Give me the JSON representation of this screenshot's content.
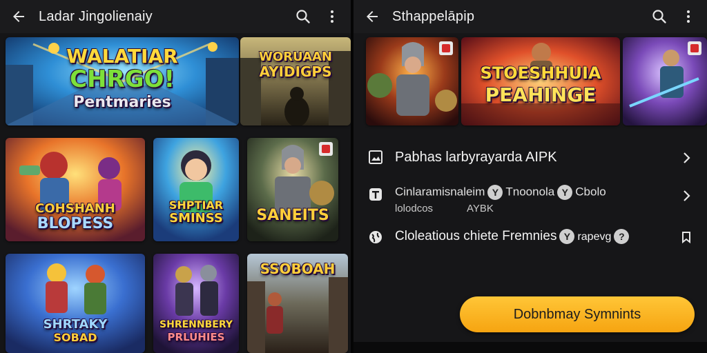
{
  "left": {
    "title": "Ladar Jingolienaiy",
    "icons": {
      "back": "arrow-left-icon",
      "search": "search-icon",
      "more": "more-vert-icon"
    },
    "banners": [
      {
        "lines": [
          "WALATIAR",
          "CHRGO!",
          "Pentmaries"
        ]
      },
      {
        "lines": [
          "WORUAAN",
          "AYIDIGPS"
        ]
      }
    ],
    "tiles": [
      {
        "lines": [
          "COHSHANH",
          "BLOPESS"
        ]
      },
      {
        "lines": [
          "SHPTIAR",
          "SMINSS"
        ]
      },
      {
        "lines": [
          "SANEITS"
        ]
      },
      {
        "lines": [
          "SHRTAKY",
          "SOBAD"
        ]
      },
      {
        "lines": [
          "SHRENNBERY",
          "PRLUHIES"
        ]
      },
      {
        "lines": [
          "SSOBOAH"
        ]
      }
    ]
  },
  "right": {
    "title": "Sthappelāpip",
    "icons": {
      "back": "arrow-left-icon",
      "search": "search-icon",
      "more": "more-vert-icon"
    },
    "hero": {
      "center_lines": [
        "STOESHHUIA",
        "PEAHINGE"
      ]
    },
    "rows": [
      {
        "icon": "image-icon",
        "text": "Pabhas larbyrayarda AIPK",
        "chevron": "chevron-right-icon"
      },
      {
        "icon": "tag-icon",
        "text": "Cinlaramisnaleim",
        "chip1": "Y",
        "mid": "Tnoonola",
        "chip2": "Y",
        "tail": "Cbolo",
        "sub_left": "lolodcos",
        "sub_right": "AYBK",
        "chevron": "chevron-right-icon"
      },
      {
        "icon": "globe-icon",
        "text": "Cloleatious chiete Fremnies",
        "chip1": "Y",
        "mid": "rapevg",
        "chip2": "?",
        "chevron": "bookmark-icon"
      }
    ],
    "cta": "Dobnbmay Symnints"
  },
  "colors": {
    "accent": "#f6a411",
    "appbar": "#1b1b1d",
    "background": "#151517"
  }
}
